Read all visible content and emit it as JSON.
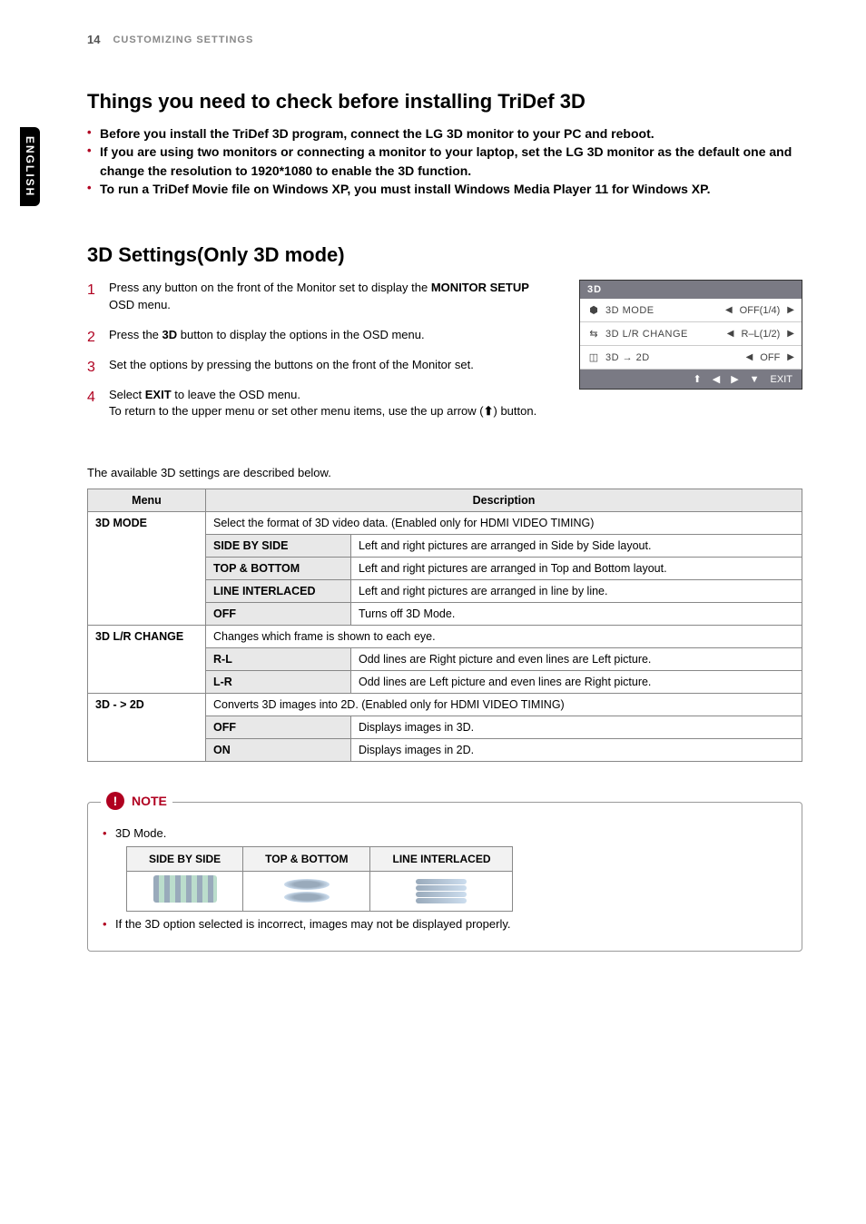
{
  "header": {
    "page_number": "14",
    "section": "CUSTOMIZING SETTINGS"
  },
  "language_tab": "ENGLISH",
  "section1": {
    "title": "Things you need to check before installing TriDef 3D",
    "bullets": [
      "Before you install the TriDef 3D program, connect the LG 3D monitor to your PC and reboot.",
      "If you are using two monitors or connecting a monitor to your laptop, set the LG 3D monitor as the default one and change the resolution to 1920*1080 to enable the 3D function.",
      "To run a TriDef Movie file on Windows XP, you must install Windows Media Player 11 for Windows XP."
    ]
  },
  "section2": {
    "title": "3D Settings(Only 3D mode)",
    "steps": {
      "s1a": "Press any button on the front of the Monitor set to display the ",
      "s1b": "MONITOR SETUP",
      "s1c": " OSD menu.",
      "s2a": "Press the ",
      "s2b": "3D",
      "s2c": " button to display the options in the OSD menu.",
      "s3": "Set the options by pressing the buttons on the front of the Monitor set.",
      "s4a": "Select ",
      "s4b": "EXIT",
      "s4c": " to leave the OSD menu.",
      "s4d": "To return to the upper menu or set other menu items, use the up arrow (",
      "s4e": ") button."
    }
  },
  "osd": {
    "title": "3D",
    "rows": [
      {
        "icon": "⬢",
        "label": "3D MODE",
        "value": "OFF(1/4)"
      },
      {
        "icon": "⇆",
        "label": "3D L/R CHANGE",
        "value": "R–L(1/2)"
      },
      {
        "icon": "◫",
        "label": "3D → 2D",
        "value": "OFF"
      }
    ],
    "nav": {
      "up": "⬆",
      "left": "◀",
      "right": "▶",
      "down": "▼",
      "exit": "EXIT"
    }
  },
  "available_text": "The available 3D settings are described below.",
  "table": {
    "head_menu": "Menu",
    "head_desc": "Description",
    "r1": {
      "label": "3D MODE",
      "desc": "Select the format of 3D video data.  (Enabled only for HDMI VIDEO TIMING)"
    },
    "r1a": {
      "k": "SIDE BY SIDE",
      "v": "Left and right pictures are arranged in Side by Side layout."
    },
    "r1b": {
      "k": "TOP & BOTTOM",
      "v": "Left and right pictures are arranged in Top and Bottom layout."
    },
    "r1c": {
      "k": "LINE INTERLACED",
      "v": "Left and right pictures are arranged in line by line."
    },
    "r1d": {
      "k": "OFF",
      "v": "Turns off 3D Mode."
    },
    "r2": {
      "label": "3D L/R CHANGE",
      "desc": "Changes which frame is shown to each eye."
    },
    "r2a": {
      "k": "R-L",
      "v": "Odd lines are Right picture and even lines are Left picture."
    },
    "r2b": {
      "k": "L-R",
      "v": "Odd lines are Left picture and even lines are Right picture."
    },
    "r3": {
      "label": "3D  - >  2D",
      "desc": "Converts 3D images into 2D. (Enabled only for HDMI VIDEO TIMING)"
    },
    "r3a": {
      "k": "OFF",
      "v": "Displays images in 3D."
    },
    "r3b": {
      "k": "ON",
      "v": "Displays images in 2D."
    }
  },
  "note": {
    "title": "NOTE",
    "b1": "3D Mode.",
    "modes": {
      "h1": "SIDE BY SIDE",
      "h2": "TOP & BOTTOM",
      "h3": "LINE INTERLACED"
    },
    "b2": "If the 3D option selected is incorrect, images may not be displayed properly."
  }
}
